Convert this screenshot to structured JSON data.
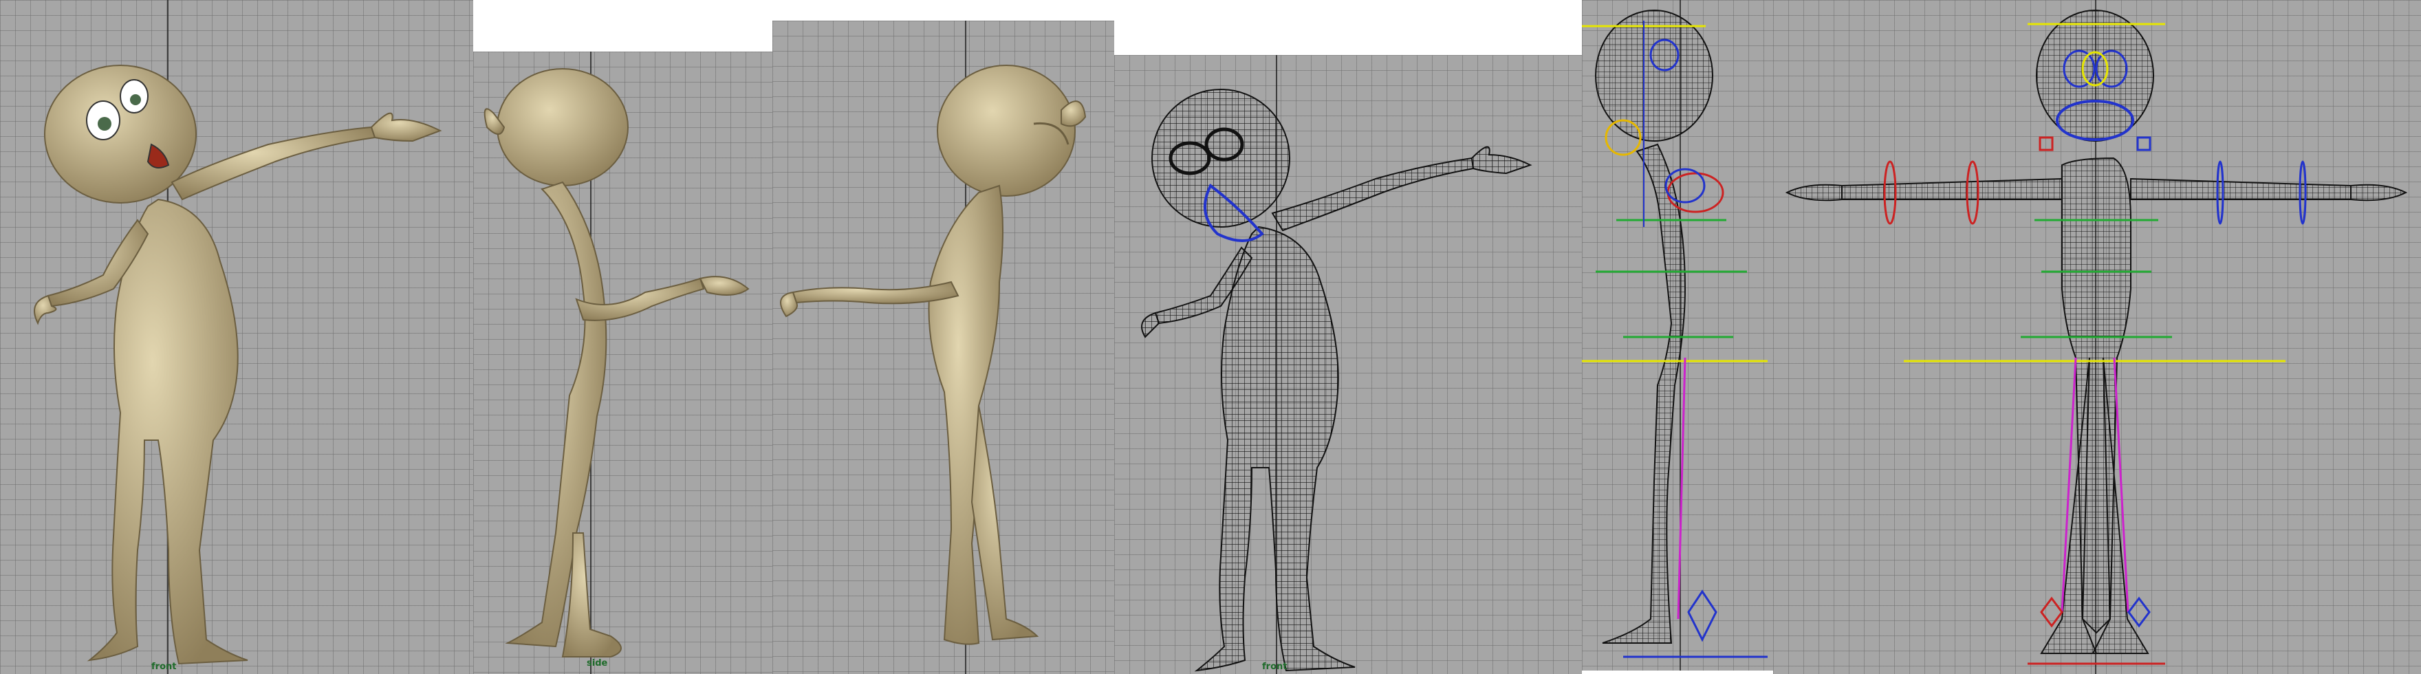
{
  "viewports": [
    {
      "id": "front-shaded",
      "label": "front",
      "style": "shaded"
    },
    {
      "id": "side-shaded-back",
      "label": "side",
      "style": "shaded"
    },
    {
      "id": "side-shaded-front",
      "label": "",
      "style": "shaded"
    },
    {
      "id": "front-wireframe",
      "label": "front",
      "style": "wireframe"
    },
    {
      "id": "side-rig",
      "label": "",
      "style": "rig-wireframe"
    },
    {
      "id": "front-rig-tpose",
      "label": "",
      "style": "rig-wireframe"
    }
  ],
  "colors": {
    "viewport_bg": "#a6a6a6",
    "grid_line": "#6e6e6e",
    "skin": "#c9b98f",
    "skin_shadow": "#8f7f5a",
    "wire": "#111111",
    "rig_blue": "#2233cc",
    "rig_red": "#cc2222",
    "rig_green": "#22aa33",
    "rig_yellow": "#e6e600",
    "rig_magenta": "#cc22cc",
    "label_green": "#1e6b2a"
  }
}
